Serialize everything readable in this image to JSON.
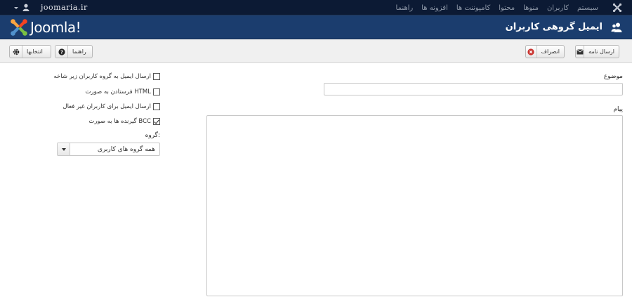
{
  "topbar": {
    "site_name": "joomaria.ir",
    "menu": [
      "سیستم",
      "کاربران",
      "منوها",
      "محتوا",
      "کامپوننت ها",
      "افزونه ها",
      "راهنما"
    ]
  },
  "header": {
    "logo_text": "Joomla!",
    "title": "ایمیل گروهی کاربران"
  },
  "toolbar": {
    "send_label": "ارسال نامه",
    "cancel_label": "انصراف",
    "help_label": "راهنما",
    "options_label": "انتخابها"
  },
  "form": {
    "subject_label": "موضوع",
    "subject_value": "",
    "message_label": "پیام",
    "message_value": "",
    "options": [
      {
        "label": "ارسال ایمیل به گروه کاربران زیر شاخه",
        "checked": false
      },
      {
        "label": "فرستادن به صورت HTML",
        "checked": false
      },
      {
        "label": "ارسال ایمیل برای کاربران غیر فعال",
        "checked": false
      },
      {
        "label": "گیرنده ها به صورت BCC",
        "checked": true
      }
    ],
    "group_label": "گروه:",
    "group_selected": "همه گروه های کاربری"
  },
  "colors": {
    "topbar_bg": "#0c1a34",
    "header_bg": "#1b3d6e",
    "toolbar_bg": "#f0f0f0",
    "cancel_icon": "#c9302c"
  },
  "icons": [
    "joomla-icon",
    "user-icon",
    "users-icon",
    "envelope-icon",
    "cancel-icon",
    "help-icon",
    "gear-icon",
    "chevron-down-icon",
    "resize-grip-icon"
  ]
}
